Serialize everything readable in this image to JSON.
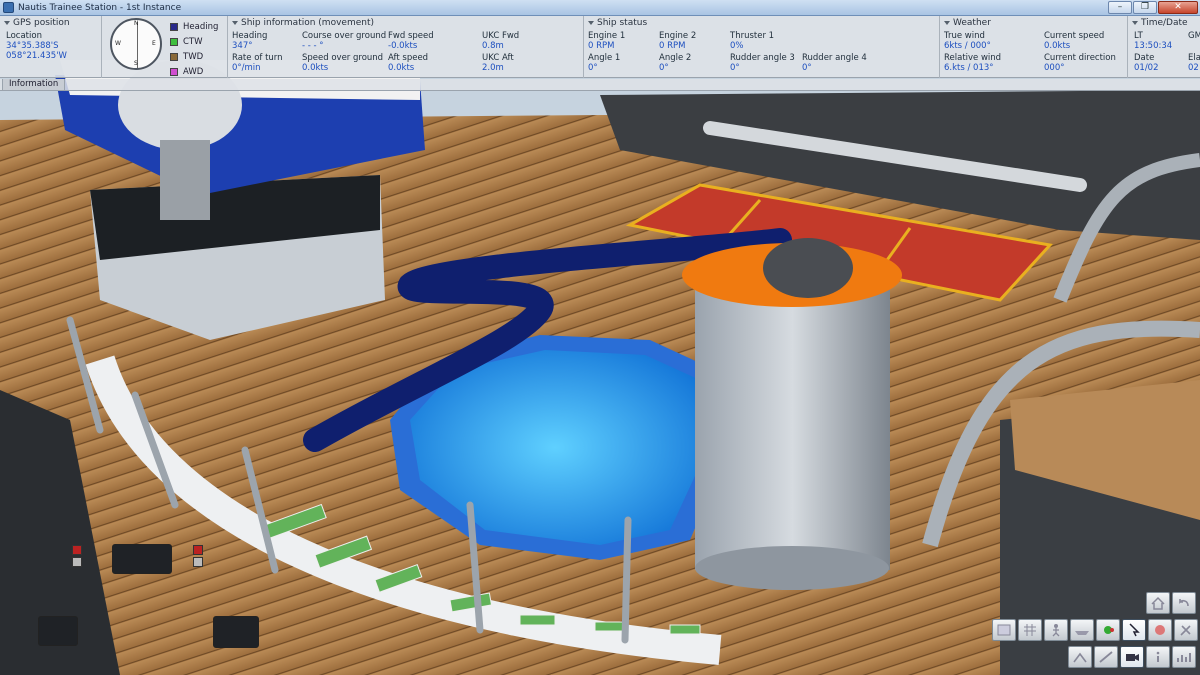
{
  "window": {
    "title": "Nautis Trainee Station - 1st Instance",
    "min": "–",
    "max": "❐",
    "close": "✕"
  },
  "gps": {
    "title": "GPS position",
    "location_label": "Location",
    "lat": "34°35.388'S",
    "lon": "058°21.435'W"
  },
  "compass": {
    "marks": [
      "N",
      "E",
      "S",
      "W"
    ]
  },
  "legend": [
    {
      "label": "Heading",
      "color": "#2a2a8a"
    },
    {
      "label": "CTW",
      "color": "#3fbf3f"
    },
    {
      "label": "TWD",
      "color": "#8a6a3a"
    },
    {
      "label": "AWD",
      "color": "#d04fd0"
    }
  ],
  "ship_info": {
    "title": "Ship information (movement)",
    "heading_label": "Heading",
    "heading": "347°",
    "cog_label": "Course over ground",
    "cog": "- - - °",
    "fwd_speed_label": "Fwd speed",
    "fwd_speed": "-0.0kts",
    "ukc_fwd_label": "UKC Fwd",
    "ukc_fwd": "0.8m",
    "rot_label": "Rate of turn",
    "rot": "0°/min",
    "sog_label": "Speed over ground",
    "sog": "0.0kts",
    "aft_speed_label": "Aft speed",
    "aft_speed": "0.0kts",
    "ukc_aft_label": "UKC Aft",
    "ukc_aft": "2.0m"
  },
  "ship_status": {
    "title": "Ship status",
    "engine1_label": "Engine 1",
    "engine1": "0 RPM",
    "engine2_label": "Engine 2",
    "engine2": "0 RPM",
    "thruster1_label": "Thruster 1",
    "thruster1": "0%",
    "angle1_label": "Angle 1",
    "angle1": "0°",
    "angle2_label": "Angle 2",
    "angle2": "0°",
    "rudder3_label": "Rudder angle 3",
    "rudder3": "0°",
    "rudder4_label": "Rudder angle 4",
    "rudder4": "0°"
  },
  "weather": {
    "title": "Weather",
    "true_wind_label": "True wind",
    "true_wind": "6kts / 000°",
    "current_speed_label": "Current speed",
    "current_speed": "0.0kts",
    "rel_wind_label": "Relative wind",
    "rel_wind": "6.kts / 013°",
    "current_dir_label": "Current direction",
    "current_dir": "000°"
  },
  "time": {
    "title": "Time/Date",
    "lt_label": "LT",
    "lt": "13:50:34",
    "gm_label": "GM",
    "gm": "",
    "date_label": "Date",
    "date": "01/02",
    "ela_label": "Ela",
    "ela": "02"
  },
  "info_tab": "Information"
}
